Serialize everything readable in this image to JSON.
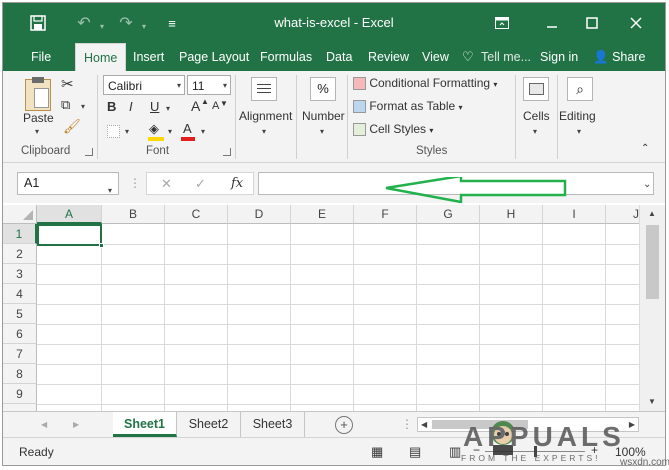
{
  "window": {
    "title": "what-is-excel - Excel",
    "quick_access": [
      "save-icon",
      "undo-icon",
      "redo-icon",
      "customize-icon"
    ],
    "controls": [
      "ribbon-display-icon",
      "minimize-icon",
      "maximize-icon",
      "close-icon"
    ]
  },
  "tabs": {
    "file": "File",
    "home": "Home",
    "insert": "Insert",
    "page_layout": "Page Layout",
    "formulas": "Formulas",
    "data": "Data",
    "review": "Review",
    "view": "View",
    "tell_me": "Tell me...",
    "sign_in": "Sign in",
    "share": "Share"
  },
  "ribbon": {
    "clipboard": {
      "label": "Clipboard",
      "paste": "Paste"
    },
    "font": {
      "label": "Font",
      "name": "Calibri",
      "size": "11",
      "bold": "B",
      "italic": "I",
      "underline": "U",
      "grow": "A",
      "shrink": "A",
      "font_color": "A"
    },
    "alignment": {
      "label": "Alignment"
    },
    "number": {
      "label": "Number",
      "symbol": "%"
    },
    "styles": {
      "label": "Styles",
      "conditional": "Conditional Formatting",
      "table": "Format as Table",
      "cell_styles": "Cell Styles"
    },
    "cells": {
      "label": "Cells"
    },
    "editing": {
      "label": "Editing"
    }
  },
  "formula_bar": {
    "name_box": "A1",
    "fx": "fx",
    "cancel": "✕",
    "enter": "✓",
    "value": "",
    "annotation_arrow_color": "#22b14c"
  },
  "grid": {
    "columns": [
      "A",
      "B",
      "C",
      "D",
      "E",
      "F",
      "G",
      "H",
      "I",
      "J"
    ],
    "rows": [
      "1",
      "2",
      "3",
      "4",
      "5",
      "6",
      "7",
      "8",
      "9"
    ],
    "active_cell": "A1"
  },
  "sheets": [
    "Sheet1",
    "Sheet2",
    "Sheet3"
  ],
  "sheet_nav": {
    "add": "+"
  },
  "status": {
    "ready": "Ready",
    "zoom": "100%"
  },
  "watermark": {
    "logo": "APPUALS",
    "tagline": "FROM THE EXPERTS!",
    "site": "wsxdn.com"
  },
  "colors": {
    "accent": "#217346",
    "ribbon_bg": "#f3f3f3"
  }
}
